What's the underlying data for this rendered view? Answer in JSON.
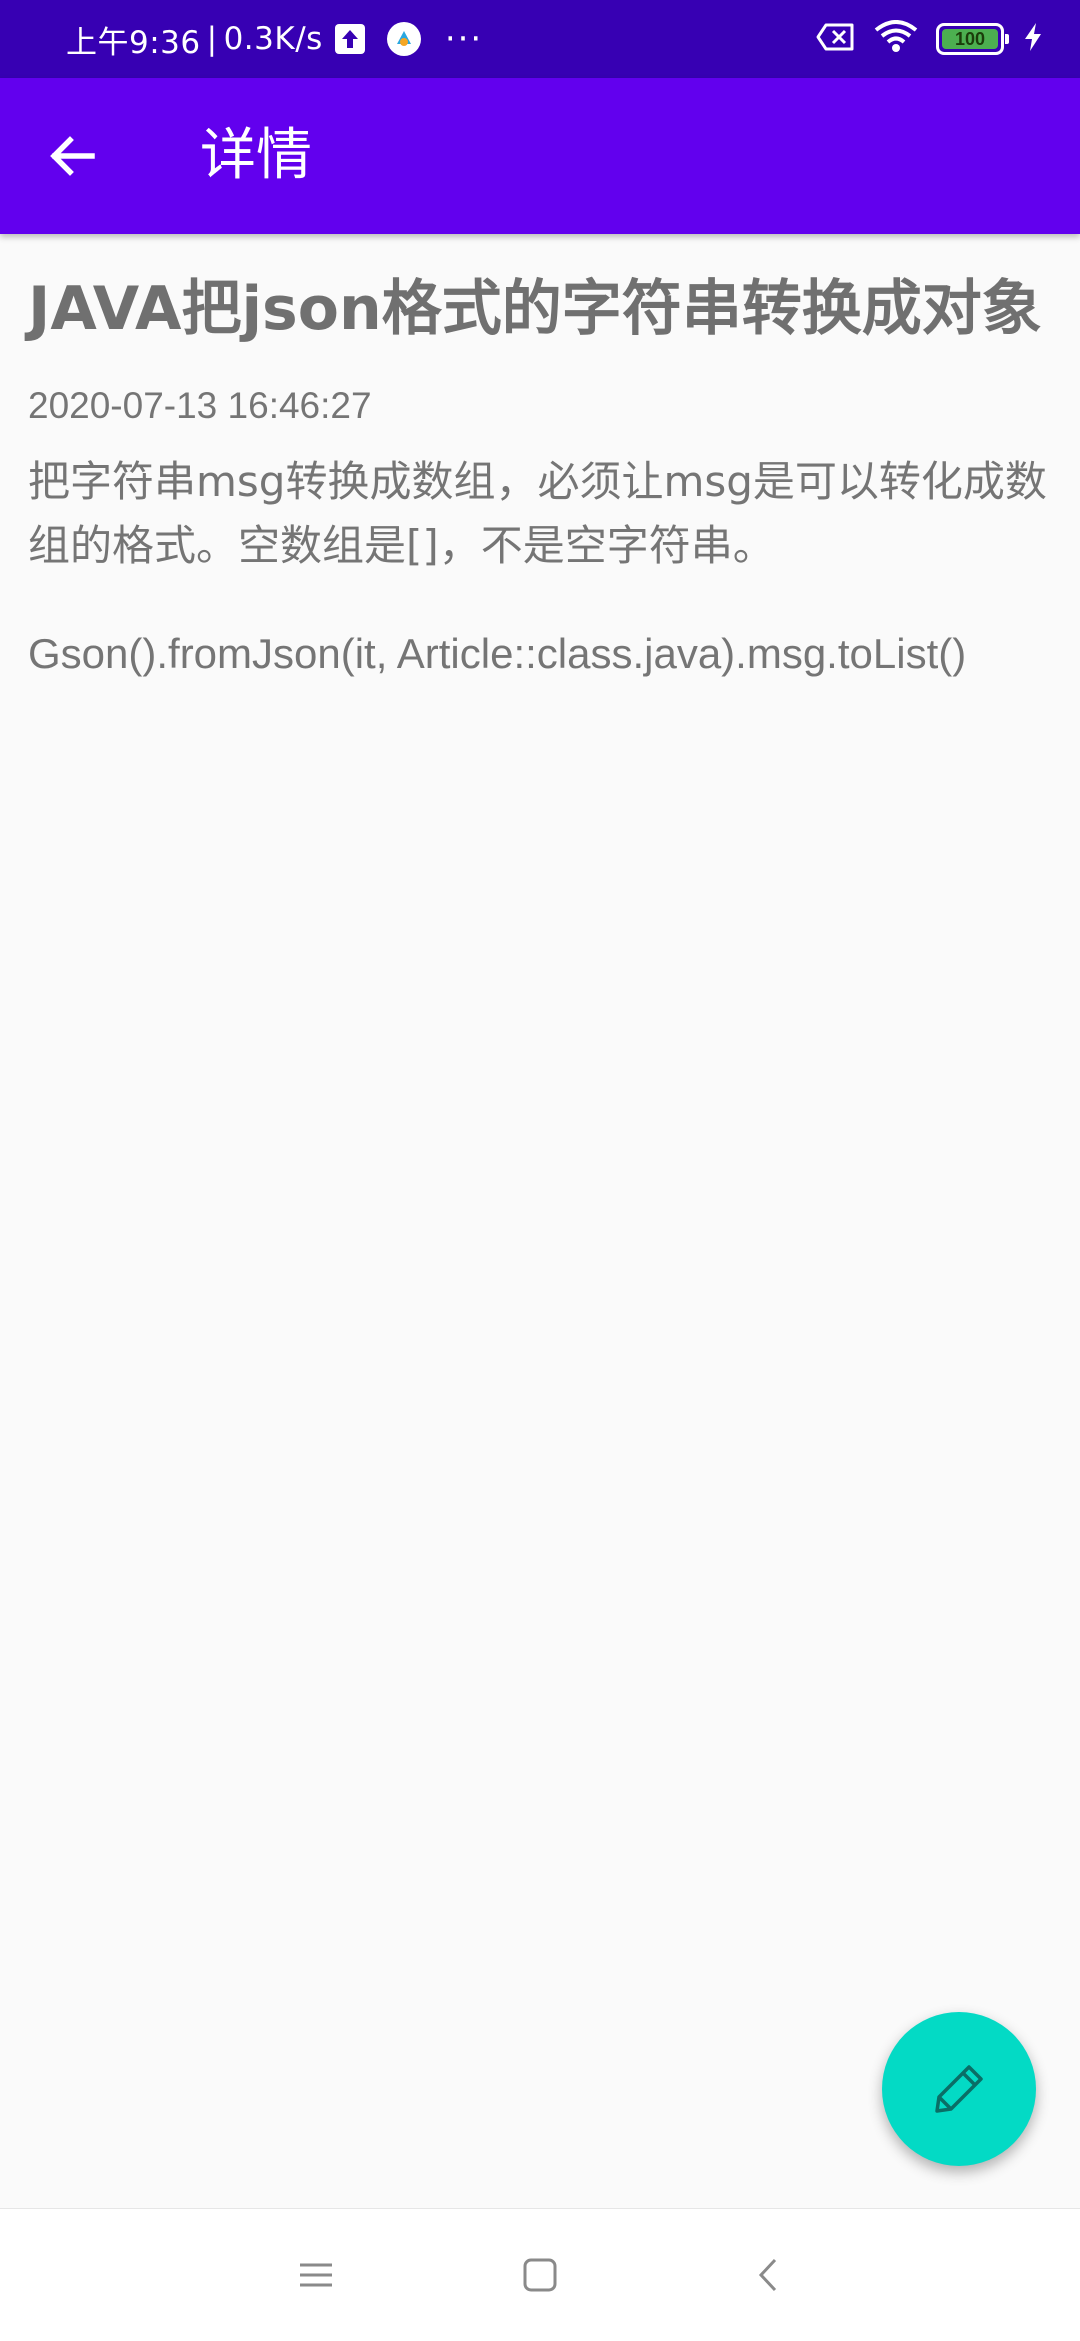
{
  "status_bar": {
    "time": "上午9:36",
    "separator": "|",
    "network_speed": "0.3K/s",
    "more_indicator": "···",
    "battery_level": "100",
    "icons": [
      "upload-icon",
      "app-notification-icon",
      "sim-error-icon",
      "wifi-icon",
      "battery-icon",
      "charging-icon"
    ]
  },
  "app_bar": {
    "title": "详情",
    "back_icon": "arrow-left-icon",
    "background": "#6200ee"
  },
  "article": {
    "title": "JAVA把json格式的字符串转换成对象",
    "date": "2020-07-13 16:46:27",
    "paragraphs": [
      "把字符串msg转换成数组，必须让msg是可以转化成数组的格式。空数组是[]，不是空字符串。",
      "Gson().fromJson(it, Article::class.java).msg.toList()"
    ]
  },
  "fab": {
    "icon": "edit-pencil-icon",
    "color": "#03dac5"
  },
  "nav_bar": {
    "icons": [
      "menu-icon",
      "home-icon",
      "back-icon"
    ]
  },
  "colors": {
    "primary": "#6200ee",
    "primary_dark": "#3700b3",
    "accent": "#03dac5",
    "text_secondary": "#757575"
  }
}
